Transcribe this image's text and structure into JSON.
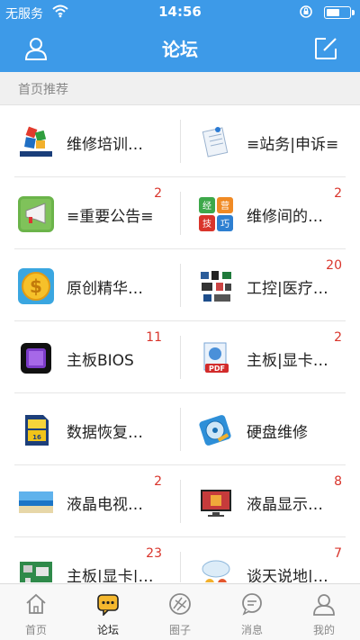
{
  "status_bar": {
    "carrier": "无服务",
    "time": "14:56",
    "battery_percent": 60
  },
  "header": {
    "title": "论坛",
    "left_icon": "user-icon",
    "right_icon": "compose-icon"
  },
  "section": {
    "label": "首页推荐"
  },
  "forums": [
    {
      "label": "维修培训…",
      "badge": "",
      "icon": "chinafix-logo-icon"
    },
    {
      "label": "≡站务|申诉≡",
      "badge": "",
      "icon": "document-pin-icon"
    },
    {
      "label": "≡重要公告≡",
      "badge": "2",
      "icon": "megaphone-icon"
    },
    {
      "label": "维修间的…",
      "badge": "2",
      "icon": "skills-tiles-icon"
    },
    {
      "label": "原创精华…",
      "badge": "",
      "icon": "dollar-coin-icon"
    },
    {
      "label": "工控|医疗…",
      "badge": "20",
      "icon": "industrial-devices-icon"
    },
    {
      "label": "主板BIOS",
      "badge": "11",
      "icon": "bios-chip-icon"
    },
    {
      "label": "主板|显卡…",
      "badge": "2",
      "icon": "pdf-document-icon"
    },
    {
      "label": "数据恢复…",
      "badge": "",
      "icon": "sd-card-icon"
    },
    {
      "label": "硬盘维修",
      "badge": "",
      "icon": "hard-disk-icon"
    },
    {
      "label": "液晶电视…",
      "badge": "2",
      "icon": "tv-screen-icon"
    },
    {
      "label": "液晶显示…",
      "badge": "8",
      "icon": "monitor-icon"
    },
    {
      "label": "主板|显卡|…",
      "badge": "23",
      "icon": "circuit-board-icon"
    },
    {
      "label": "谈天说地|…",
      "badge": "7",
      "icon": "chat-people-icon"
    }
  ],
  "tabs": [
    {
      "label": "首页",
      "icon": "home-icon",
      "active": false
    },
    {
      "label": "论坛",
      "icon": "forum-chat-icon",
      "active": true
    },
    {
      "label": "圈子",
      "icon": "circle-icon",
      "active": false
    },
    {
      "label": "消息",
      "icon": "message-icon",
      "active": false
    },
    {
      "label": "我的",
      "icon": "profile-icon",
      "active": false
    }
  ],
  "colors": {
    "primary": "#3d9ae8",
    "badge": "#d9342b",
    "active_tab_icon": "#f5b82e"
  }
}
